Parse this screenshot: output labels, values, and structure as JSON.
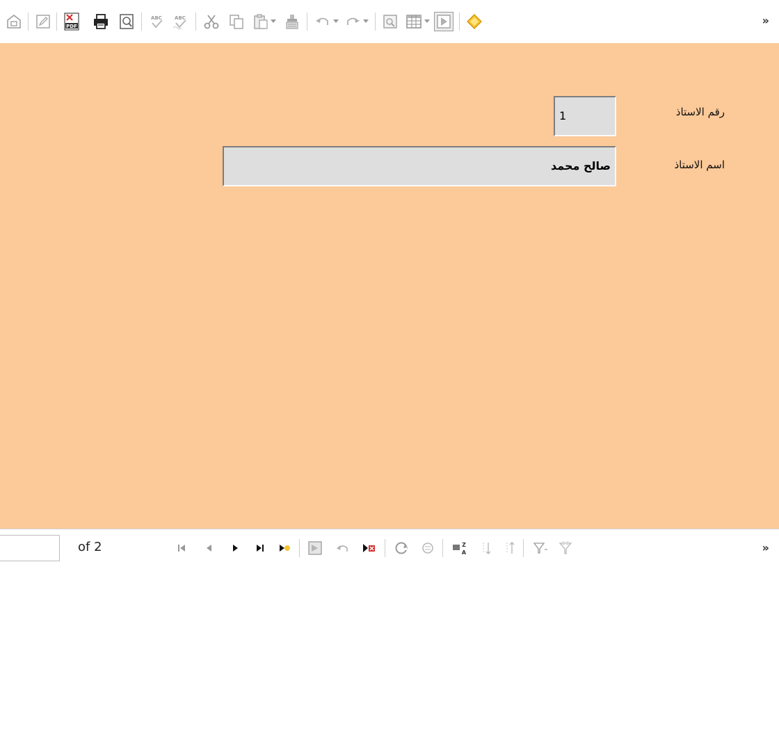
{
  "toolbar": {
    "icons": [
      "edit-file-icon",
      "edit-mode-icon",
      "export-pdf-icon",
      "print-icon",
      "print-preview-icon",
      "spelling-icon",
      "autospell-icon",
      "cut-icon",
      "copy-icon",
      "paste-icon",
      "clone-formatting-icon",
      "undo-icon",
      "redo-icon",
      "navigator-icon",
      "table-icon",
      "design-mode-icon",
      "wizard-icon"
    ],
    "more": "»"
  },
  "form": {
    "background": "#fcc998",
    "fields": [
      {
        "label": "رقم الاستاذ",
        "value": "1"
      },
      {
        "label": "اسم الاستاذ",
        "value": "صالح محمد"
      }
    ]
  },
  "navigation": {
    "record_value": "",
    "of_label": "of 2",
    "icons": [
      "first-record-icon",
      "previous-record-icon",
      "next-record-icon",
      "last-record-icon",
      "new-record-icon",
      "save-record-icon",
      "undo-record-icon",
      "delete-record-icon",
      "refresh-icon",
      "refresh-control-icon",
      "sort-icon",
      "sort-ascending-icon",
      "sort-descending-icon",
      "autofilter-icon",
      "form-filter-icon"
    ],
    "more": "»"
  }
}
